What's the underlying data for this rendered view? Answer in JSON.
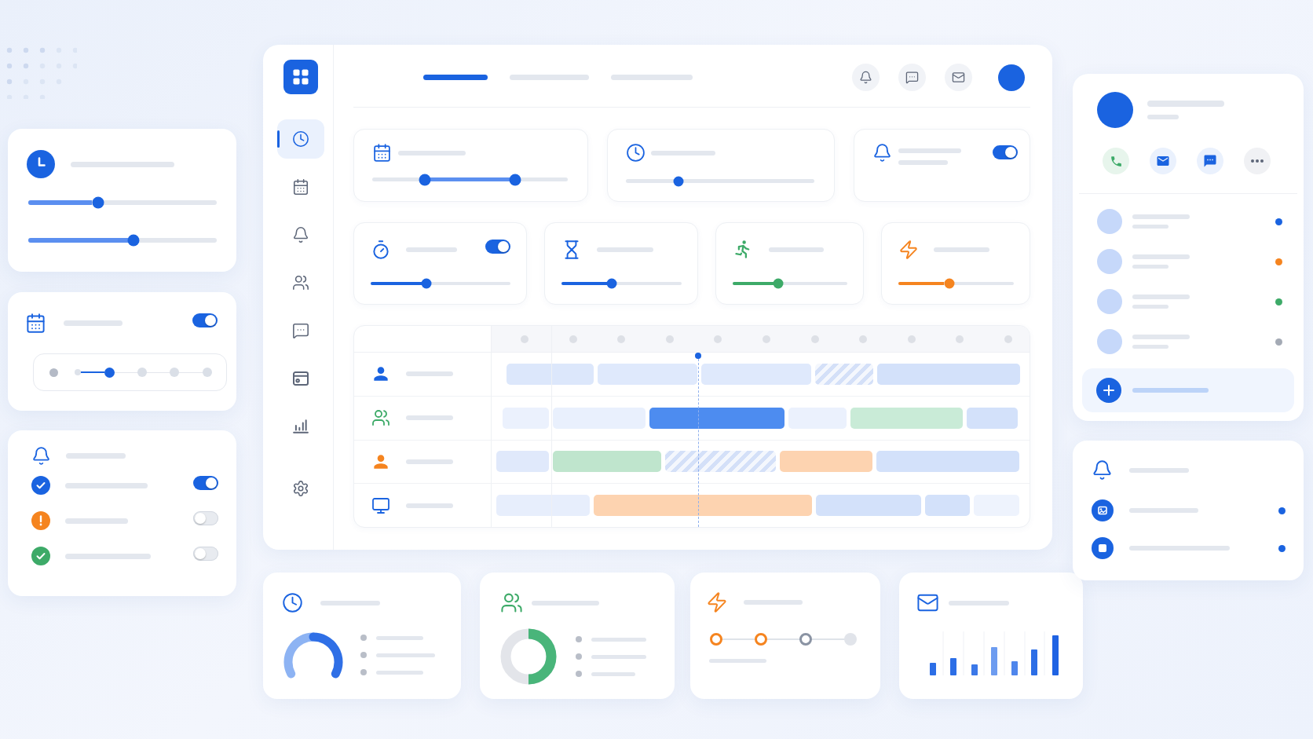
{
  "left_column": {
    "timer_card": {
      "sliders": [
        {
          "level": 0.37
        },
        {
          "level": 0.56
        }
      ]
    },
    "schedule_card": {
      "toggle": {
        "on": true
      },
      "steps": [
        {
          "selected": false
        },
        {
          "selected": true
        },
        {
          "selected": false
        },
        {
          "selected": false
        },
        {
          "selected": false
        }
      ]
    },
    "notifications_card": {
      "rows": [
        {
          "kind": "check",
          "color": "#1a63e0",
          "toggle": {
            "on": true
          }
        },
        {
          "kind": "alert",
          "color": "#f5841f",
          "toggle": {
            "on": false
          }
        },
        {
          "kind": "check",
          "color": "#3daa68",
          "toggle": {
            "on": false
          }
        }
      ]
    }
  },
  "dashboard": {
    "sidebar": {
      "items": [
        {
          "selected": true
        },
        {
          "selected": false
        },
        {
          "selected": false
        },
        {
          "selected": false
        },
        {
          "selected": false
        },
        {
          "selected": false
        },
        {
          "selected": false
        },
        {
          "selected": false
        }
      ]
    },
    "tabs": [
      {
        "selected": true
      },
      {
        "selected": false
      },
      {
        "selected": false
      }
    ],
    "filter_cards": [
      {
        "kind": "range",
        "thumbs": [
          {
            "level": 0.27
          },
          {
            "level": 0.73
          }
        ]
      },
      {
        "kind": "slider",
        "level": 0.28
      },
      {
        "kind": "toggle",
        "toggle": {
          "on": true
        }
      }
    ],
    "metric_cards": [
      {
        "color": "#1a63e0",
        "level": 0.4,
        "toggle": {
          "on": true
        }
      },
      {
        "color": "#1a63e0",
        "level": 0.42
      },
      {
        "color": "#3daa68",
        "level": 0.4
      },
      {
        "color": "#f5841f",
        "level": 0.44
      }
    ],
    "timeline": {
      "rows": [
        {
          "color": "#1a63e0",
          "bars": [
            {
              "kind": "solid",
              "color": "#dce7fb"
            },
            {
              "kind": "solid",
              "color": "#dfe9fc"
            },
            {
              "kind": "solid",
              "color": "#dfe9fc"
            },
            {
              "kind": "hatched",
              "color": "#d4e0f8"
            },
            {
              "kind": "solid",
              "color": "#d3e1fa"
            }
          ]
        },
        {
          "color": "#3daa68",
          "bars": [
            {
              "kind": "solid",
              "color": "#ebf1fd"
            },
            {
              "kind": "solid",
              "color": "#e9f0fd"
            },
            {
              "kind": "solid",
              "color": "#4d8cf0"
            },
            {
              "kind": "solid",
              "color": "#ebf1fd"
            },
            {
              "kind": "solid",
              "color": "#c9ebd7"
            },
            {
              "kind": "solid",
              "color": "#d3e1fa"
            }
          ]
        },
        {
          "color": "#f5841f",
          "bars": [
            {
              "kind": "solid",
              "color": "#e0e9fb"
            },
            {
              "kind": "solid",
              "color": "#bfe5cd"
            },
            {
              "kind": "hatched",
              "color": "#d4e0f8"
            },
            {
              "kind": "solid",
              "color": "#fdd3b0"
            },
            {
              "kind": "solid",
              "color": "#d3e1fa"
            }
          ]
        },
        {
          "color": "#1a63e0",
          "bars": [
            {
              "kind": "solid",
              "color": "#e7eefc"
            },
            {
              "kind": "solid",
              "color": "#fdd3b0"
            },
            {
              "kind": "solid",
              "color": "#d3e1fa"
            },
            {
              "kind": "solid",
              "color": "#d3e1fa"
            },
            {
              "kind": "solid",
              "color": "#eef3fd"
            }
          ]
        }
      ]
    }
  },
  "profile_card": {
    "contacts": [
      {
        "color": "#1a63e0"
      },
      {
        "color": "#f5841f"
      },
      {
        "color": "#3daa68"
      },
      {
        "color": "#a4aab5"
      }
    ]
  },
  "summary_cards": {
    "progress_steps": [
      {
        "kind": "done"
      },
      {
        "kind": "done"
      },
      {
        "kind": "current"
      },
      {
        "kind": "pending"
      }
    ]
  }
}
